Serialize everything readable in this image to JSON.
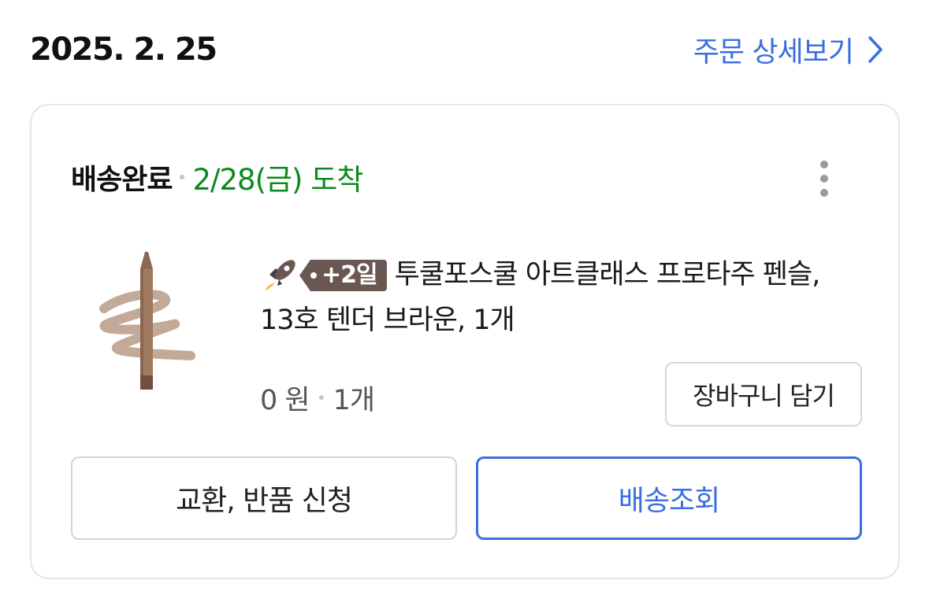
{
  "header": {
    "order_date": "2025. 2. 25",
    "detail_link": "주문 상세보기"
  },
  "card": {
    "status": "배송완료",
    "arrival": "2/28(금) 도착",
    "product": {
      "badge": "+2일",
      "title_line1": "투쿨포스쿨 아트클래스 프로타주 펜슬,",
      "title_line2": "13호 텐더 브라운, 1개",
      "price": "0 원",
      "quantity": "1개"
    },
    "cart_button": "장바구니 담기",
    "exchange_button": "교환, 반품 신청",
    "track_button": "배송조회"
  },
  "colors": {
    "accent_blue": "#3a6fe0",
    "arrival_green": "#0a8a1c",
    "badge_brown": "#6b5752"
  },
  "icons": [
    "chevron-right-icon",
    "more-vertical-icon",
    "rocket-icon"
  ]
}
